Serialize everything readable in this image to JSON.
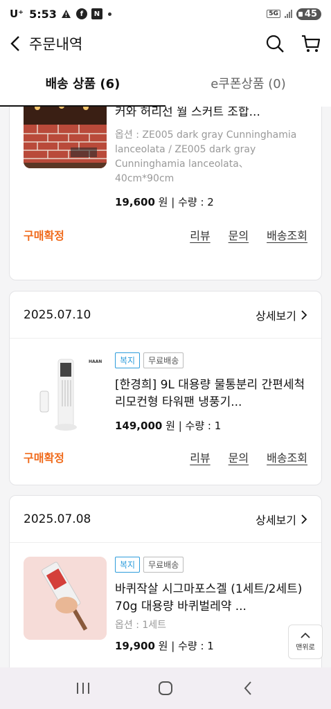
{
  "status_bar": {
    "carrier": "U⁺",
    "time": "5:53",
    "network": "5G",
    "battery": "45"
  },
  "header": {
    "title": "주문내역"
  },
  "tabs": [
    {
      "label": "배송 상품 (6)",
      "active": true
    },
    {
      "label": "e쿠폰상품 (0)",
      "active": false
    }
  ],
  "orders": [
    {
      "date": "",
      "detail_label": "",
      "product_name": "[직구전문관]방수 및 기름 방지 벽 스티커와 허리선 월 스커트 조합...",
      "badges": [],
      "option": "옵션 : ZE005 dark gray Cunninghamia lanceolata / ZE005 dark gray Cunninghamia lanceolata、40cm*90cm",
      "price": "19,600",
      "price_unit": "원",
      "qty_label": "| 수량 : 2",
      "status": "구매확정",
      "links": [
        "리뷰",
        "문의",
        "배송조회"
      ]
    },
    {
      "date": "2025.07.10",
      "detail_label": "상세보기",
      "product_name": "[한경희] 9L 대용량 물통분리 간편세척 리모컨형 타워팬 냉풍기...",
      "badges": [
        "복지",
        "무료배송"
      ],
      "option": "",
      "price": "149,000",
      "price_unit": "원",
      "qty_label": "| 수량 : 1",
      "status": "구매확정",
      "links": [
        "리뷰",
        "문의",
        "배송조회"
      ],
      "brand_mark": "HAAN"
    },
    {
      "date": "2025.07.08",
      "detail_label": "상세보기",
      "product_name": "바퀴작살 시그마포스겔 (1세트/2세트) 70g 대용량 바퀴벌레약 ...",
      "badges": [
        "복지",
        "무료배송"
      ],
      "option": "옵션 : 1세트",
      "price": "19,900",
      "price_unit": "원",
      "qty_label": "| 수량 : 1"
    }
  ],
  "back_to_top": "맨위로",
  "colors": {
    "accent_orange": "#f06b1c",
    "badge_blue": "#2d9cdb"
  }
}
